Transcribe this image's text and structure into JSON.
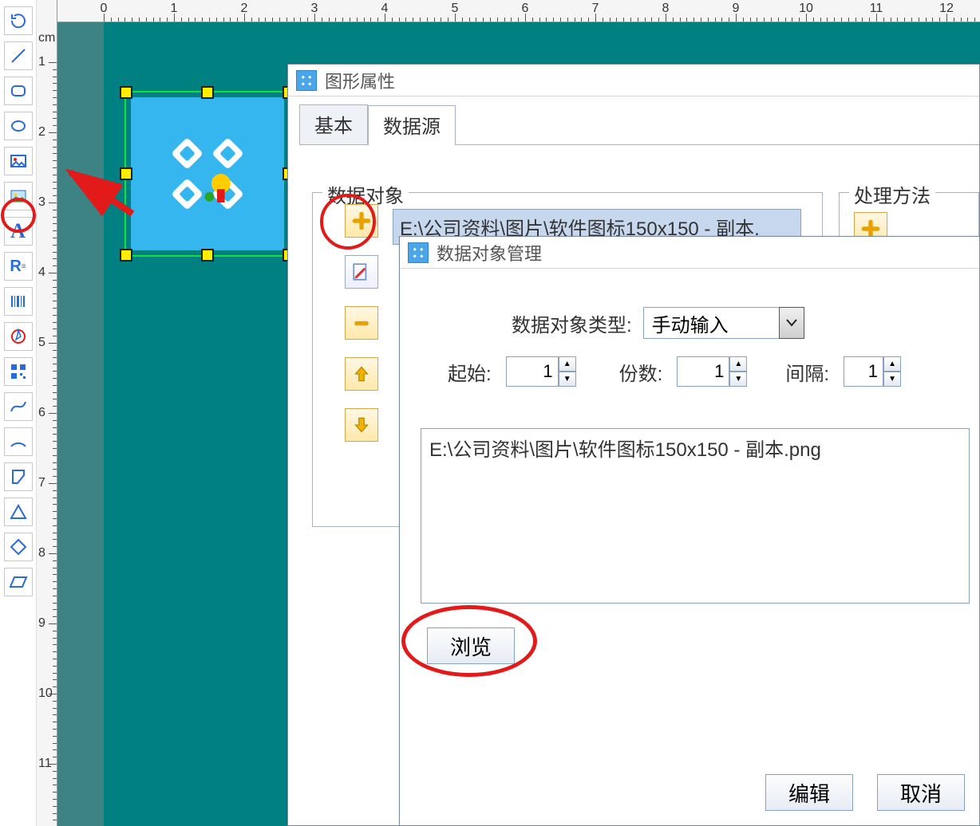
{
  "ruler": {
    "h_numbers": [
      "0",
      "1",
      "2",
      "3",
      "4",
      "5",
      "6",
      "7",
      "8",
      "9",
      "10",
      "11",
      "12"
    ],
    "v_numbers": [
      "1",
      "2",
      "3",
      "4",
      "5",
      "6",
      "7",
      "8",
      "9",
      "10",
      "11"
    ],
    "unit_label": "cm"
  },
  "tools": [
    "rotate-tool",
    "line-tool",
    "round-rect-tool",
    "ellipse-tool",
    "insert-image-tool",
    "picture-tool",
    "text-tool",
    "rich-text-tool",
    "barcode-tool",
    "polygon-tool",
    "qr-tool",
    "curve-tool",
    "arc-tool",
    "shape-tool",
    "triangle-tool",
    "diamond-tool",
    "parallelogram-tool"
  ],
  "tool_labels": {
    "text-tool": "A",
    "rich-text-tool": "R"
  },
  "properties_dialog": {
    "title": "图形属性",
    "tabs": {
      "basic": "基本",
      "data_source": "数据源"
    },
    "group_data_object": "数据对象",
    "group_process_method": "处理方法",
    "selected_item": "E:\\公司资料\\图片\\软件图标150x150 - 副本."
  },
  "data_manager_dialog": {
    "title": "数据对象管理",
    "type_label": "数据对象类型:",
    "type_value": "手动输入",
    "start_label": "起始:",
    "start_value": "1",
    "copies_label": "份数:",
    "copies_value": "1",
    "interval_label": "间隔:",
    "interval_value": "1",
    "path_value": "E:\\公司资料\\图片\\软件图标150x150 - 副本.png",
    "browse_btn": "浏览",
    "edit_btn": "编辑",
    "cancel_btn": "取消"
  }
}
